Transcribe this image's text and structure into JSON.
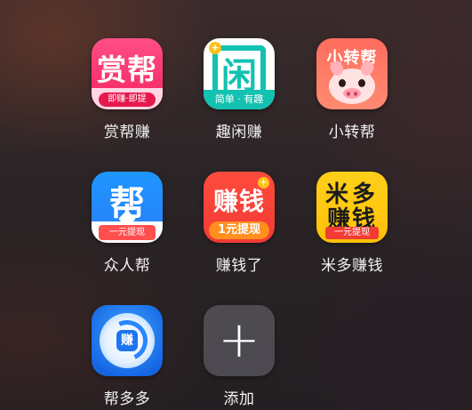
{
  "apps": [
    {
      "label": "赏帮赚",
      "icon_main": "赏帮",
      "icon_sub": "即赚·即提",
      "accent": "#f4235f"
    },
    {
      "label": "趣闲赚",
      "icon_main": "闲",
      "icon_sub": "简单 · 有趣",
      "accent": "#13c1b1"
    },
    {
      "label": "小转帮",
      "icon_main": "小转帮",
      "icon": "pig-icon",
      "accent": "#ff6d5e"
    },
    {
      "label": "众人帮",
      "icon_main": "帮",
      "icon_sub": "一元提现",
      "accent": "#2a7ef7"
    },
    {
      "label": "赚钱了",
      "icon_main": "赚钱",
      "icon_sub": "1元提现",
      "accent": "#f23b34"
    },
    {
      "label": "米多赚钱",
      "icon_main_line1": "米多",
      "icon_main_line2": "赚钱",
      "icon_sub": "一元提现",
      "accent": "#ffc107"
    },
    {
      "label": "帮多多",
      "icon_main": "赚",
      "accent": "#1565e3"
    },
    {
      "label": "添加",
      "icon": "plus-icon"
    }
  ]
}
